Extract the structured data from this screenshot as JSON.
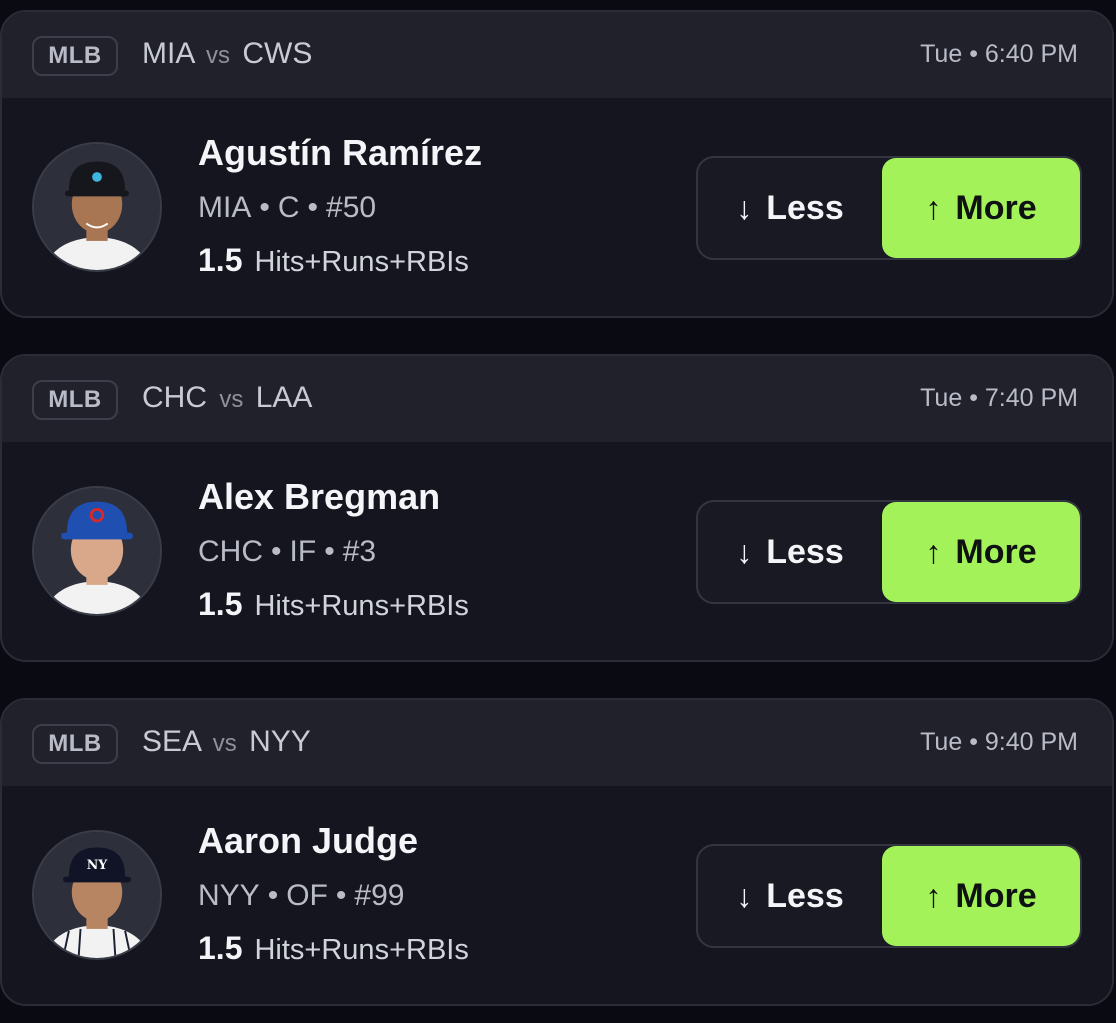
{
  "cards": [
    {
      "league": "MLB",
      "team_a": "MIA",
      "vs": "vs",
      "team_b": "CWS",
      "time": "Tue • 6:40 PM",
      "player_name": "Agustín Ramírez",
      "team": "MIA",
      "position": "C",
      "number": "#50",
      "line": "1.5",
      "stat": "Hits+Runs+RBIs",
      "less_label": "Less",
      "more_label": "More",
      "selected": "more",
      "cap_color": "#15171c",
      "cap_logo_color": "#3fb6e0",
      "jersey_color": "#f2f2f2",
      "skin_color": "#a97654"
    },
    {
      "league": "MLB",
      "team_a": "CHC",
      "vs": "vs",
      "team_b": "LAA",
      "time": "Tue • 7:40 PM",
      "player_name": "Alex Bregman",
      "team": "CHC",
      "position": "IF",
      "number": "#3",
      "line": "1.5",
      "stat": "Hits+Runs+RBIs",
      "less_label": "Less",
      "more_label": "More",
      "selected": "more",
      "cap_color": "#1f4fb0",
      "cap_logo_color": "#d42a2a",
      "jersey_color": "#f2f2f2",
      "skin_color": "#d9a88a"
    },
    {
      "league": "MLB",
      "team_a": "SEA",
      "vs": "vs",
      "team_b": "NYY",
      "time": "Tue • 9:40 PM",
      "player_name": "Aaron Judge",
      "team": "NYY",
      "position": "OF",
      "number": "#99",
      "line": "1.5",
      "stat": "Hits+Runs+RBIs",
      "less_label": "Less",
      "more_label": "More",
      "selected": "more",
      "cap_color": "#101426",
      "cap_logo_color": "#ffffff",
      "jersey_color": "#f2f2f2",
      "skin_color": "#b88563"
    }
  ],
  "icons": {
    "less": "arrow-down-icon",
    "more": "arrow-up-icon",
    "avatar": "player-headshot"
  },
  "colors": {
    "accent_more": "#a4f25a",
    "background": "#0a0b12",
    "card": "#14151e",
    "header": "#20212b"
  }
}
